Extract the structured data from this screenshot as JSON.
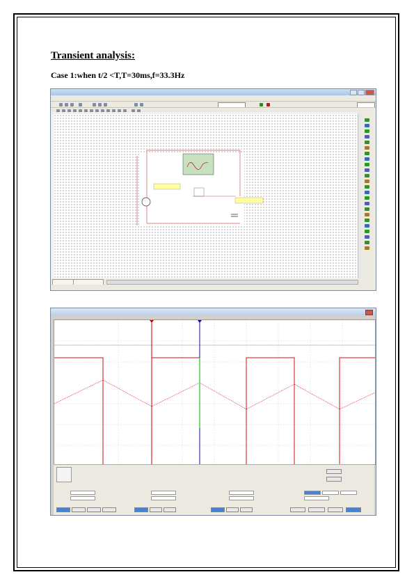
{
  "document": {
    "heading": "Transient analysis:",
    "case_label": "Case 1:when t/2 <T,T=30ms,f=33.3Hz"
  },
  "colors": {
    "waveform_channel_a": "#d01010",
    "waveform_channel_b": "#d01010",
    "cursor_1": "#cc0000",
    "cursor_2": "#1010a0",
    "cursor_highlight": "#20c020"
  },
  "screenshot_1": {
    "description_icons": [
      "schematic-canvas",
      "component-palette"
    ]
  },
  "screenshot_2": {
    "icons": [
      "close-icon"
    ]
  }
}
